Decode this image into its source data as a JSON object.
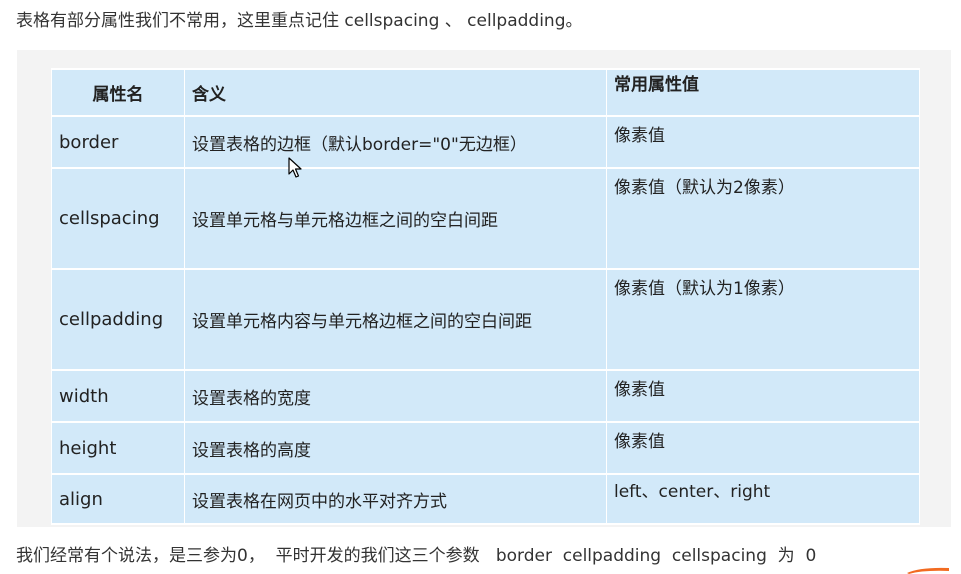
{
  "intro_text": "表格有部分属性我们不常用，这里重点记住 cellspacing 、 cellpadding。",
  "table": {
    "headers": {
      "name": "属性名",
      "meaning": "含义",
      "value": "常用属性值"
    },
    "rows": [
      {
        "name": "border",
        "meaning": "设置表格的边框（默认border=\"0\"无边框）",
        "value": "像素值"
      },
      {
        "name": "cellspacing",
        "meaning": "设置单元格与单元格边框之间的空白间距",
        "value": "像素值（默认为2像素）"
      },
      {
        "name": "cellpadding",
        "meaning": "设置单元格内容与单元格边框之间的空白间距",
        "value": "像素值（默认为1像素）"
      },
      {
        "name": "width",
        "meaning": "设置表格的宽度",
        "value": "像素值"
      },
      {
        "name": "height",
        "meaning": "设置表格的高度",
        "value": "像素值"
      },
      {
        "name": "align",
        "meaning": "设置表格在网页中的水平对齐方式",
        "value": "left、center、right"
      }
    ]
  },
  "outro_text": "我们经常有个说法，是三参为0，  平时开发的我们这三个参数   border  cellpadding  cellspacing  为  0",
  "colors": {
    "table_background": "#d2e9f9",
    "panel_background": "#f3f3f3",
    "grid_lines": "#ffffff",
    "corner_mark": "#f26b21"
  },
  "icons": {
    "cursor": "mouse-pointer-icon"
  }
}
